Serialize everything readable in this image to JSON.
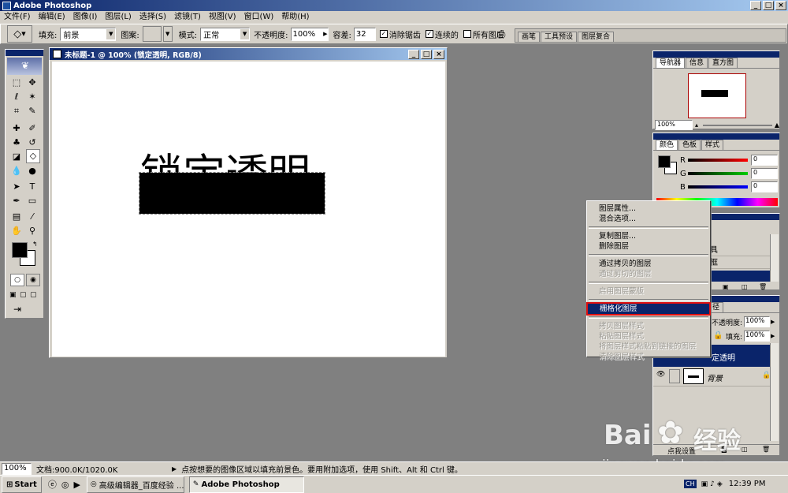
{
  "app": {
    "title": "Adobe Photoshop"
  },
  "menu": [
    "文件(F)",
    "编辑(E)",
    "图像(I)",
    "图层(L)",
    "选择(S)",
    "滤镜(T)",
    "视图(V)",
    "窗口(W)",
    "帮助(H)"
  ],
  "options": {
    "fill_label": "填充:",
    "fill_value": "前景",
    "pattern_label": "图案:",
    "mode_label": "模式:",
    "mode_value": "正常",
    "opacity_label": "不透明度:",
    "opacity_value": "100%",
    "tolerance_label": "容差:",
    "tolerance_value": "32",
    "antialias_label": "消除锯齿",
    "contiguous_label": "连续的",
    "all_layers_label": "所有图层",
    "well_tabs": [
      "画笔",
      "工具预设",
      "图层复合"
    ]
  },
  "document": {
    "title": "未标题-1 @ 100% (锁定透明, RGB/8)",
    "text": "锁定透明"
  },
  "navigator": {
    "tabs": [
      "导航器",
      "信息",
      "直方图"
    ],
    "zoom": "100%"
  },
  "color": {
    "tabs": [
      "颜色",
      "色板",
      "样式"
    ],
    "channels": [
      {
        "label": "R",
        "value": "0"
      },
      {
        "label": "G",
        "value": "0"
      },
      {
        "label": "B",
        "value": "0"
      }
    ]
  },
  "layers": {
    "partial_items": [
      "具",
      "框"
    ],
    "tab_partial": "径",
    "opacity_label": "不透明度:",
    "opacity_value": "100%",
    "fill_label": "填充:",
    "fill_value": "100%",
    "layer_selected": "定透明",
    "layer_background": "背景",
    "bottom_partial": "点我设置"
  },
  "context_menu": {
    "groups": [
      [
        {
          "label": "图层属性...",
          "enabled": true
        },
        {
          "label": "混合选项...",
          "enabled": true
        }
      ],
      [
        {
          "label": "复制图层...",
          "enabled": true
        },
        {
          "label": "删除图层",
          "enabled": true
        }
      ],
      [
        {
          "label": "通过拷贝的图层",
          "enabled": true
        },
        {
          "label": "通过剪切的图层",
          "enabled": false
        }
      ],
      [
        {
          "label": "启用图层蒙版",
          "enabled": false
        }
      ],
      [
        {
          "label": "栅格化图层",
          "enabled": true,
          "highlighted": true
        }
      ],
      [
        {
          "label": "拷贝图层样式",
          "enabled": false
        },
        {
          "label": "粘贴图层样式",
          "enabled": false
        },
        {
          "label": "将图层样式粘贴到链接的图层",
          "enabled": false
        },
        {
          "label": "清除图层样式",
          "enabled": false
        }
      ]
    ]
  },
  "status": {
    "zoom": "100%",
    "doc_info": "文档:900.0K/1020.0K",
    "hint": "点按想要的图像区域以填充前景色。要用附加选项，使用 Shift、Alt 和 Ctrl 键。"
  },
  "taskbar": {
    "start": "Start",
    "tasks": [
      "高级编辑器_百度经验 ...",
      "Adobe Photoshop"
    ],
    "lang": "CH",
    "clock": "12:39 PM"
  },
  "watermark": {
    "brand_tail": "经验",
    "url": "jingyan.baidu.com"
  },
  "colors": {
    "title_dark": "#0a246a",
    "title_light": "#a6caf0",
    "highlight": "#0a246a",
    "outline_red": "#e01010",
    "chrome": "#d4d0c8",
    "workspace": "#808080"
  }
}
